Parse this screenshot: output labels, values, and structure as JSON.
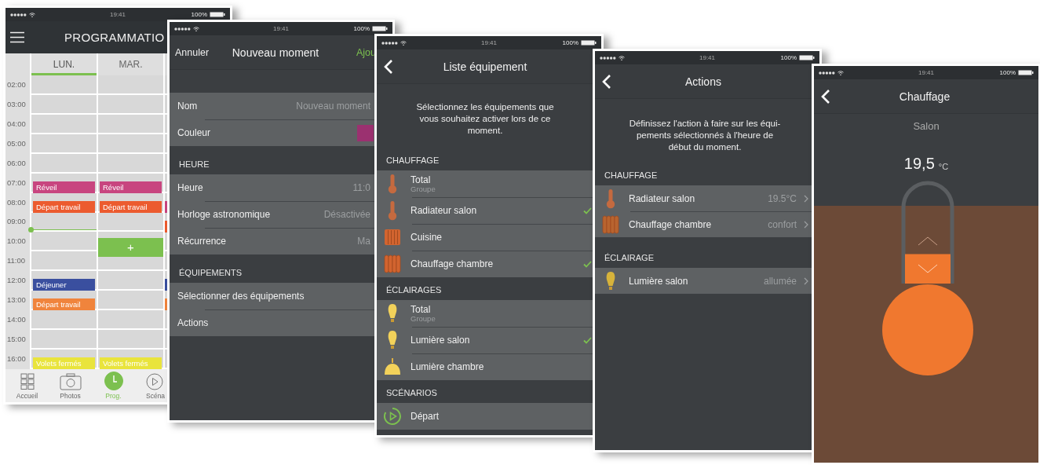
{
  "screens": [
    {
      "kind": "calendar",
      "status": {
        "time": "19:41",
        "battery": "100%"
      },
      "title": "PROGRAMMATIO",
      "days": [
        {
          "label": "LUN.",
          "selected": true
        },
        {
          "label": "MAR.",
          "selected": false
        },
        {
          "selected": false
        }
      ],
      "rows": [
        {
          "label": "02:00",
          "current": false
        },
        {
          "label": "03:00",
          "current": false
        },
        {
          "label": "04:00",
          "current": false
        },
        {
          "label": "05:00",
          "current": false
        },
        {
          "label": "06:00",
          "current": false
        },
        {
          "label": "07:00",
          "current": false,
          "day_1": {
            "kind": "event",
            "label": "Réveil",
            "color": "#c8457f"
          },
          "day_2": {
            "kind": "event",
            "label": "Réveil",
            "color": "#c8457f"
          }
        },
        {
          "label": "08:00",
          "current": false,
          "day_1": {
            "kind": "event",
            "label": "Départ travail",
            "color": "#ec5b2f"
          },
          "day_2": {
            "kind": "event",
            "label": "Départ travail",
            "color": "#ec5b2f"
          },
          "day_3": {
            "kind": "event",
            "color": "#c8457f"
          }
        },
        {
          "label": "09:00",
          "current": true,
          "day_3": {
            "kind": "event",
            "color": "#ec5b2f"
          }
        },
        {
          "label": "10:00",
          "current": false,
          "day_2": {
            "kind": "add",
            "label": "+",
            "color": "#7cc04f"
          }
        },
        {
          "label": "11:00",
          "current": false
        },
        {
          "label": "12:00",
          "current": false,
          "day_1": {
            "kind": "event",
            "label": "Déjeuner",
            "color": "#3a4f9f"
          },
          "day_3": {
            "kind": "event",
            "color": "#3a4f9f"
          }
        },
        {
          "label": "13:00",
          "current": false,
          "day_1": {
            "kind": "event",
            "label": "Départ travail",
            "color": "#f0843c"
          },
          "day_3": {
            "kind": "event",
            "color": "#f0843c"
          }
        },
        {
          "label": "14:00",
          "current": false
        },
        {
          "label": "15:00",
          "current": false
        },
        {
          "label": "16:00",
          "current": false,
          "day_1": {
            "kind": "event",
            "label": "Volets fermés",
            "color": "#e9e43c"
          },
          "day_2": {
            "kind": "event",
            "label": "Volets fermés",
            "color": "#e9e43c"
          }
        }
      ],
      "tabs": [
        {
          "kind": "grid",
          "label": "Accueil",
          "selected": false
        },
        {
          "kind": "camera",
          "label": "Photos",
          "selected": false
        },
        {
          "kind": "clock",
          "label": "Prog.",
          "selected": true
        },
        {
          "kind": "play",
          "label": "Scéna",
          "selected": false
        }
      ]
    },
    {
      "kind": "form",
      "status": {
        "time": "19:41",
        "battery": "100%"
      },
      "cancel": "Annuler",
      "title": "Nouveau moment",
      "confirm": "Ajou",
      "sections": [
        {
          "rows": [
            {
              "label": "Nom",
              "placeholder": "Nouveau moment"
            },
            {
              "label": "Couleur",
              "color": "#9b3170"
            }
          ]
        },
        {
          "header": "HEURE",
          "rows": [
            {
              "label": "Heure",
              "value": "11:0"
            },
            {
              "label": "Horloge astronomique",
              "value": "Désactivée"
            },
            {
              "label": "Récurrence",
              "value": "Ma"
            }
          ]
        },
        {
          "header": "ÉQUIPEMENTS",
          "rows": [
            {
              "label": "Sélectionner des équipements"
            },
            {
              "label": "Actions"
            }
          ]
        }
      ]
    },
    {
      "kind": "equipment",
      "status": {
        "time": "19:41",
        "battery": "100%"
      },
      "title": "Liste équipement",
      "intro": "Sélectionnez les équipements que vous souhaitez activer lors de ce moment.",
      "sections": [
        {
          "header": "CHAUFFAGE",
          "items": [
            {
              "kind": "thermometer",
              "name": "Total",
              "subtitle": "Groupe",
              "checked": false
            },
            {
              "kind": "thermometer",
              "name": "Radiateur salon",
              "checked": true
            },
            {
              "kind": "radiator",
              "name": "Cuisine",
              "checked": false
            },
            {
              "kind": "heater",
              "name": "Chauffage chambre",
              "checked": true
            }
          ]
        },
        {
          "header": "ÉCLAIRAGES",
          "items": [
            {
              "kind": "bulb",
              "name": "Total",
              "subtitle": "Groupe",
              "checked": false
            },
            {
              "kind": "bulb",
              "name": "Lumière salon",
              "checked": true
            },
            {
              "kind": "lamp",
              "name": "Lumière chambre",
              "checked": false
            }
          ]
        },
        {
          "header": "SCÉNARIOS",
          "items": [
            {
              "kind": "play",
              "name": "Départ",
              "checked": false
            }
          ]
        }
      ]
    },
    {
      "kind": "actions",
      "status": {
        "time": "19:41",
        "battery": "100%"
      },
      "title": "Actions",
      "intro": "Définissez l'action à faire sur les équi-pements sélectionnés à l'heure de début du moment.",
      "sections": [
        {
          "header": "CHAUFFAGE",
          "items": [
            {
              "kind": "thermometer",
              "name": "Radiateur salon",
              "value": "19.5°C"
            },
            {
              "kind": "heater",
              "name": "Chauffage chambre",
              "value": "confort"
            }
          ]
        },
        {
          "header": "ÉCLAIRAGE",
          "items": [
            {
              "kind": "bulb",
              "name": "Lumière salon",
              "value": "allumée"
            }
          ]
        }
      ]
    },
    {
      "kind": "thermostat",
      "status": {
        "time": "19:41",
        "battery": "100%"
      },
      "title": "Chauffage",
      "room": "Salon",
      "temperature": "19,5",
      "unit": "°C",
      "level": 0.3
    }
  ]
}
